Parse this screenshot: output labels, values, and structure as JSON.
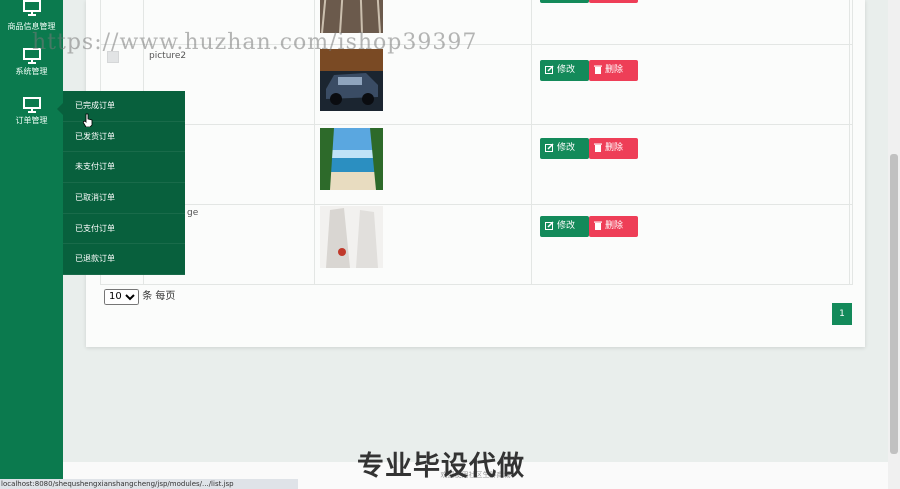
{
  "sidebar": {
    "items": [
      {
        "label": "商品信息管理",
        "icon": "monitor-icon"
      },
      {
        "label": "系统管理",
        "icon": "monitor-icon"
      },
      {
        "label": "订单管理",
        "icon": "monitor-icon"
      }
    ]
  },
  "submenu": {
    "items": [
      "已完成订单",
      "已发货订单",
      "未支付订单",
      "已取消订单",
      "已支付订单",
      "已退款订单"
    ]
  },
  "table": {
    "rows": [
      {
        "name": ""
      },
      {
        "name": "picture2"
      },
      {
        "name": ""
      },
      {
        "name": "ge"
      }
    ],
    "edit_label": "修改",
    "delete_label": "删除"
  },
  "pager": {
    "page_size": "10",
    "page_size_options": [
      "10"
    ],
    "suffix": "条 每页",
    "current_page": "1"
  },
  "footer": {
    "text": "欢迎使用社区生鲜商城"
  },
  "statusbar": {
    "url": "localhost:8080/shequshengxianshangcheng/jsp/modules/.../list.jsp"
  },
  "watermark": {
    "text": "https://www.huzhan.com/ishop39397",
    "banner": "专业毕设代做"
  },
  "colors": {
    "sidebar": "#0b7a4e",
    "submenu": "#08603d",
    "edit": "#138a5a",
    "delete": "#ee3e57"
  }
}
